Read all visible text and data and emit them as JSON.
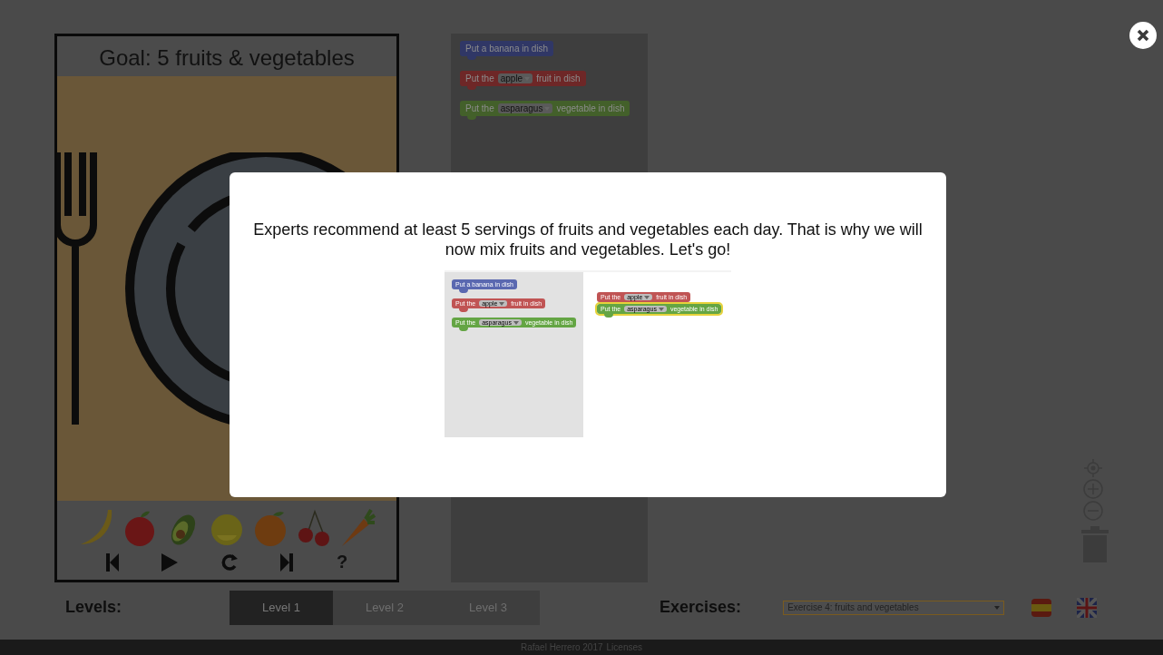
{
  "game": {
    "goal": "Goal: 5 fruits & vegetables",
    "help": "?"
  },
  "toolbox": {
    "blocks": [
      {
        "kind": "plain",
        "color": "#303766",
        "text": "Put a banana in dish"
      },
      {
        "kind": "dropdown",
        "color": "#6e2727",
        "prefix": "Put the",
        "option": "apple",
        "suffix": "fruit in dish"
      },
      {
        "kind": "dropdown",
        "color": "#43602a",
        "prefix": "Put the",
        "option": "asparagus",
        "suffix": "vegetable in dish"
      }
    ]
  },
  "modal": {
    "message": "Experts recommend at least 5 servings of fruits and vegetables each day. That is why we will now mix fruits and vegetables. Let's go!",
    "image": {
      "toolbox_blocks": [
        {
          "kind": "plain",
          "color": "#5a68b0",
          "text": "Put a banana in dish",
          "selected": false
        },
        {
          "kind": "dropdown",
          "color": "#c05454",
          "prefix": "Put the",
          "option": "apple",
          "suffix": "fruit in dish",
          "selected": false
        },
        {
          "kind": "dropdown",
          "color": "#64a544",
          "prefix": "Put the",
          "option": "asparagus",
          "suffix": "vegetable in dish",
          "selected": false
        }
      ],
      "workspace_blocks": [
        {
          "kind": "dropdown",
          "color": "#c05454",
          "prefix": "Put the",
          "option": "apple",
          "suffix": "fruit in dish",
          "selected": false
        },
        {
          "kind": "dropdown",
          "color": "#64a544",
          "prefix": "Put the",
          "option": "asparagus",
          "suffix": "vegetable in dish",
          "selected": true
        }
      ]
    }
  },
  "levels": {
    "label": "Levels:",
    "tabs": [
      {
        "label": "Level 1",
        "selected": true
      },
      {
        "label": "Level 2",
        "selected": false
      },
      {
        "label": "Level 3",
        "selected": false
      }
    ]
  },
  "exercises": {
    "label": "Exercises:",
    "value": "Exercise 4: fruits and vegetables"
  },
  "footer": {
    "author": "Rafael Herrero 2017",
    "link": "Licenses"
  }
}
